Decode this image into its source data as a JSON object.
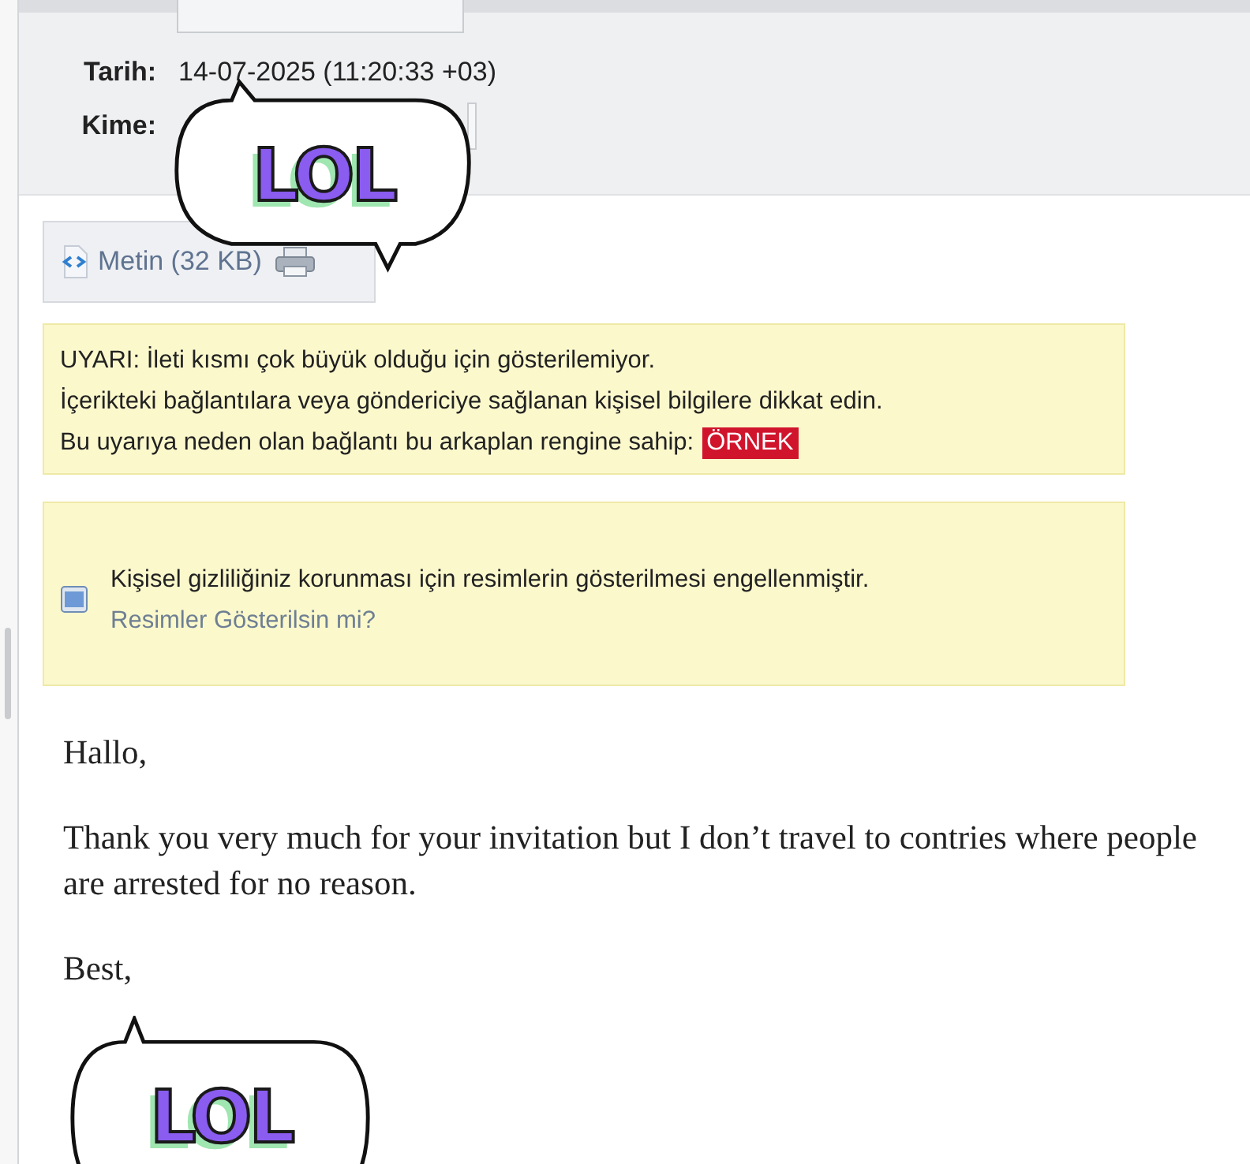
{
  "header": {
    "fields": [
      {
        "kind": "text",
        "label": "Tarih:",
        "value": "14-07-2025 (11:20:33 +03)"
      },
      {
        "kind": "box",
        "label": "Kime:"
      }
    ]
  },
  "attachment": {
    "label": "Metin (32 KB)"
  },
  "warning": {
    "lines": [
      "UYARI: İleti kısmı çok büyük olduğu için gösterilemiyor.",
      "İçerikteki bağlantılara veya göndericiye sağlanan kişisel bilgilere dikkat edin.",
      "Bu uyarıya neden olan bağlantı bu arkaplan rengine sahip:"
    ],
    "sample": "ÖRNEK"
  },
  "images_notice": {
    "text": "Kişisel gizliliğiniz korunması için resimlerin gösterilmesi engellenmiştir.",
    "link": "Resimler Gösterilsin mi?"
  },
  "body": [
    "Hallo,",
    "Thank you very much for your invitation but I don’t travel to contries where people are arrested for no reason.",
    "Best,"
  ],
  "stickers": [
    {
      "text": "LOL"
    },
    {
      "text": "LOL"
    }
  ]
}
